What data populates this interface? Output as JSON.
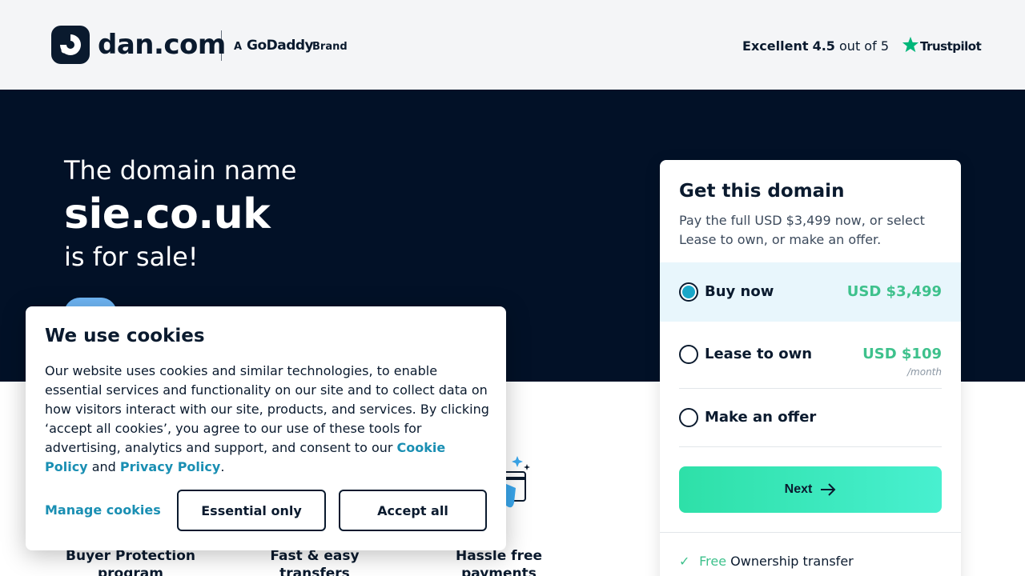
{
  "header": {
    "logo_text": "dan.com",
    "brand_prefix": "A",
    "brand_name": "GoDaddy",
    "brand_suffix": "Brand",
    "rating_word": "Excellent",
    "rating_score": "4.5",
    "rating_rest": "out of 5",
    "trustpilot": "Trustpilot",
    "trustpilot_star_color": "#00b67a"
  },
  "hero": {
    "line1": "The domain name",
    "domain": "sie.co.uk",
    "line3": "is for sale!"
  },
  "features": [
    {
      "line1": "Buyer Protection",
      "line2": "program"
    },
    {
      "line1": "Fast & easy",
      "line2": "transfers"
    },
    {
      "line1": "Hassle free",
      "line2": "payments"
    }
  ],
  "card": {
    "title": "Get this domain",
    "description": "Pay the full USD $3,499 now, or select Lease to own, or make an offer.",
    "options": [
      {
        "label": "Buy now",
        "price": "USD $3,499",
        "sub": "",
        "selected": true
      },
      {
        "label": "Lease to own",
        "price": "USD $109",
        "sub": "/month",
        "selected": false
      },
      {
        "label": "Make an offer",
        "price": "",
        "sub": "",
        "selected": false
      }
    ],
    "next_label": "Next",
    "perk_free": "Free",
    "perk_text": "Ownership transfer"
  },
  "cookie": {
    "title": "We use cookies",
    "body_part1": "Our website uses cookies and similar technologies, to enable essential services and functionality on our site and to collect data on how visitors interact with our site, products, and services. By clicking ‘accept all cookies’, you agree to our use of these tools for advertising, analytics and support, and consent to our ",
    "cookie_policy": "Cookie Policy",
    "and": " and ",
    "privacy_policy": "Privacy Policy",
    "period": ".",
    "manage_label": "Manage cookies",
    "essential_label": "Essential only",
    "accept_label": "Accept all"
  },
  "colors": {
    "navy": "#021127",
    "accent_green": "#3ec18c",
    "link_blue": "#1a8fb3"
  }
}
